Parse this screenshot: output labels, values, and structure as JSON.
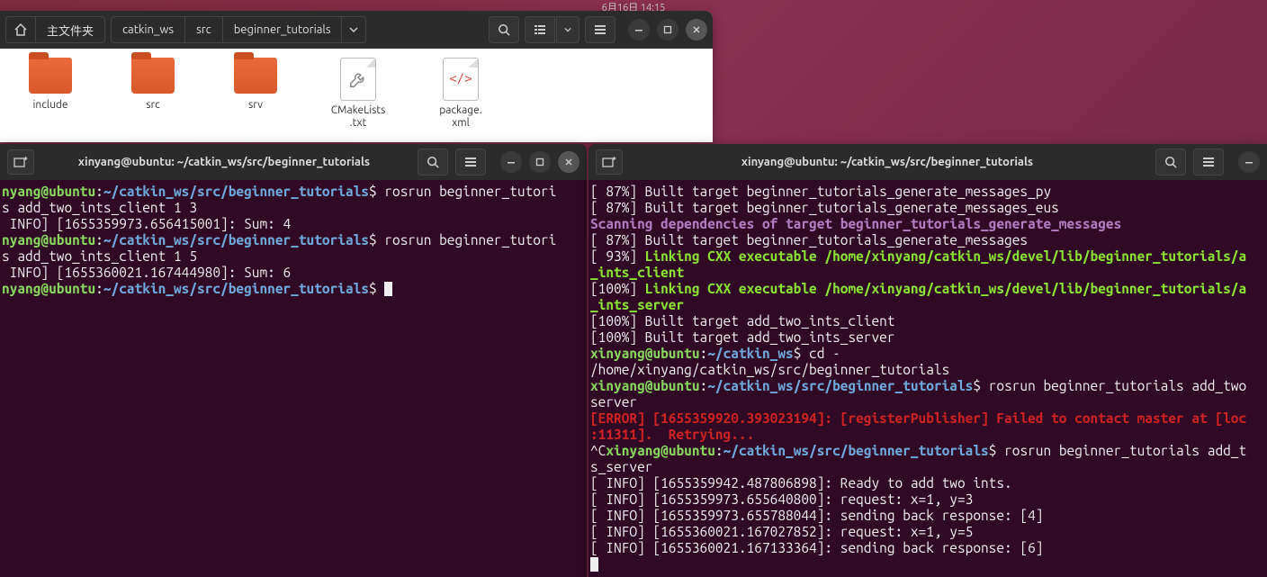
{
  "topbar": {
    "clock": "6月16日 14:15"
  },
  "nautilus": {
    "breadcrumb": {
      "home_label": "主文件夹",
      "seg1": "catkin_ws",
      "seg2": "src",
      "seg3": "beginner_tutorials"
    },
    "files": {
      "include": "include",
      "src": "src",
      "srv": "srv",
      "cmake": "CMakeLists\n.txt",
      "package": "package.\nxml"
    }
  },
  "term_left": {
    "title": "xinyang@ubuntu: ~/catkin_ws/src/beginner_tutorials",
    "userhost": "nyang@ubuntu",
    "path": "~/catkin_ws/src/beginner_tutorials",
    "cmd1a": " rosrun beginner_tutori",
    "cmd1b": "s add_two_ints_client 1 3",
    "info1": " INFO] [1655359973.656415001]: Sum: 4",
    "cmd2a": " rosrun beginner_tutori",
    "cmd2b": "s add_two_ints_client 1 5",
    "info2": " INFO] [1655360021.167444980]: Sum: 6"
  },
  "term_right": {
    "title": "xinyang@ubuntu: ~/catkin_ws/src/beginner_tutorials",
    "l1": "[ 87%] Built target beginner_tutorials_generate_messages_py",
    "l2": "[ 87%] Built target beginner_tutorials_generate_messages_eus",
    "l3": "Scanning dependencies of target beginner_tutorials_generate_messages",
    "l4": "[ 87%] Built target beginner_tutorials_generate_messages",
    "l5a": "[ 93%] ",
    "l5b": "Linking CXX executable /home/xinyang/catkin_ws/devel/lib/beginner_tutorials/a",
    "l6": "_ints_client",
    "l7a": "[100%] ",
    "l7b": "Linking CXX executable /home/xinyang/catkin_ws/devel/lib/beginner_tutorials/a",
    "l8": "_ints_server",
    "l9": "[100%] Built target add_two_ints_client",
    "l10": "[100%] Built target add_two_ints_server",
    "p1_user": "xinyang@ubuntu",
    "p1_path": "~/catkin_ws",
    "p1_cmd": "$ cd -",
    "l12": "/home/xinyang/catkin_ws/src/beginner_tutorials",
    "p2_user": "xinyang@ubuntu",
    "p2_path": "~/catkin_ws/src/beginner_tutorials",
    "p2_cmd": "$ rosrun beginner_tutorials add_two",
    "l14": "server",
    "err1": "[ERROR] [1655359920.393023194]: [registerPublisher] Failed to contact master at [loc",
    "err2": ":11311].  Retrying...",
    "p3_pre": "^C",
    "p3_user": "xinyang@ubuntu",
    "p3_path": "~/catkin_ws/src/beginner_tutorials",
    "p3_cmd": "$ rosrun beginner_tutorials add_t",
    "l18": "s_server",
    "i1": "[ INFO] [1655359942.487806898]: Ready to add two ints.",
    "i2": "[ INFO] [1655359973.655640800]: request: x=1, y=3",
    "i3": "[ INFO] [1655359973.655788044]: sending back response: [4]",
    "i4": "[ INFO] [1655360021.167027852]: request: x=1, y=5",
    "i5": "[ INFO] [1655360021.167133364]: sending back response: [6]"
  }
}
